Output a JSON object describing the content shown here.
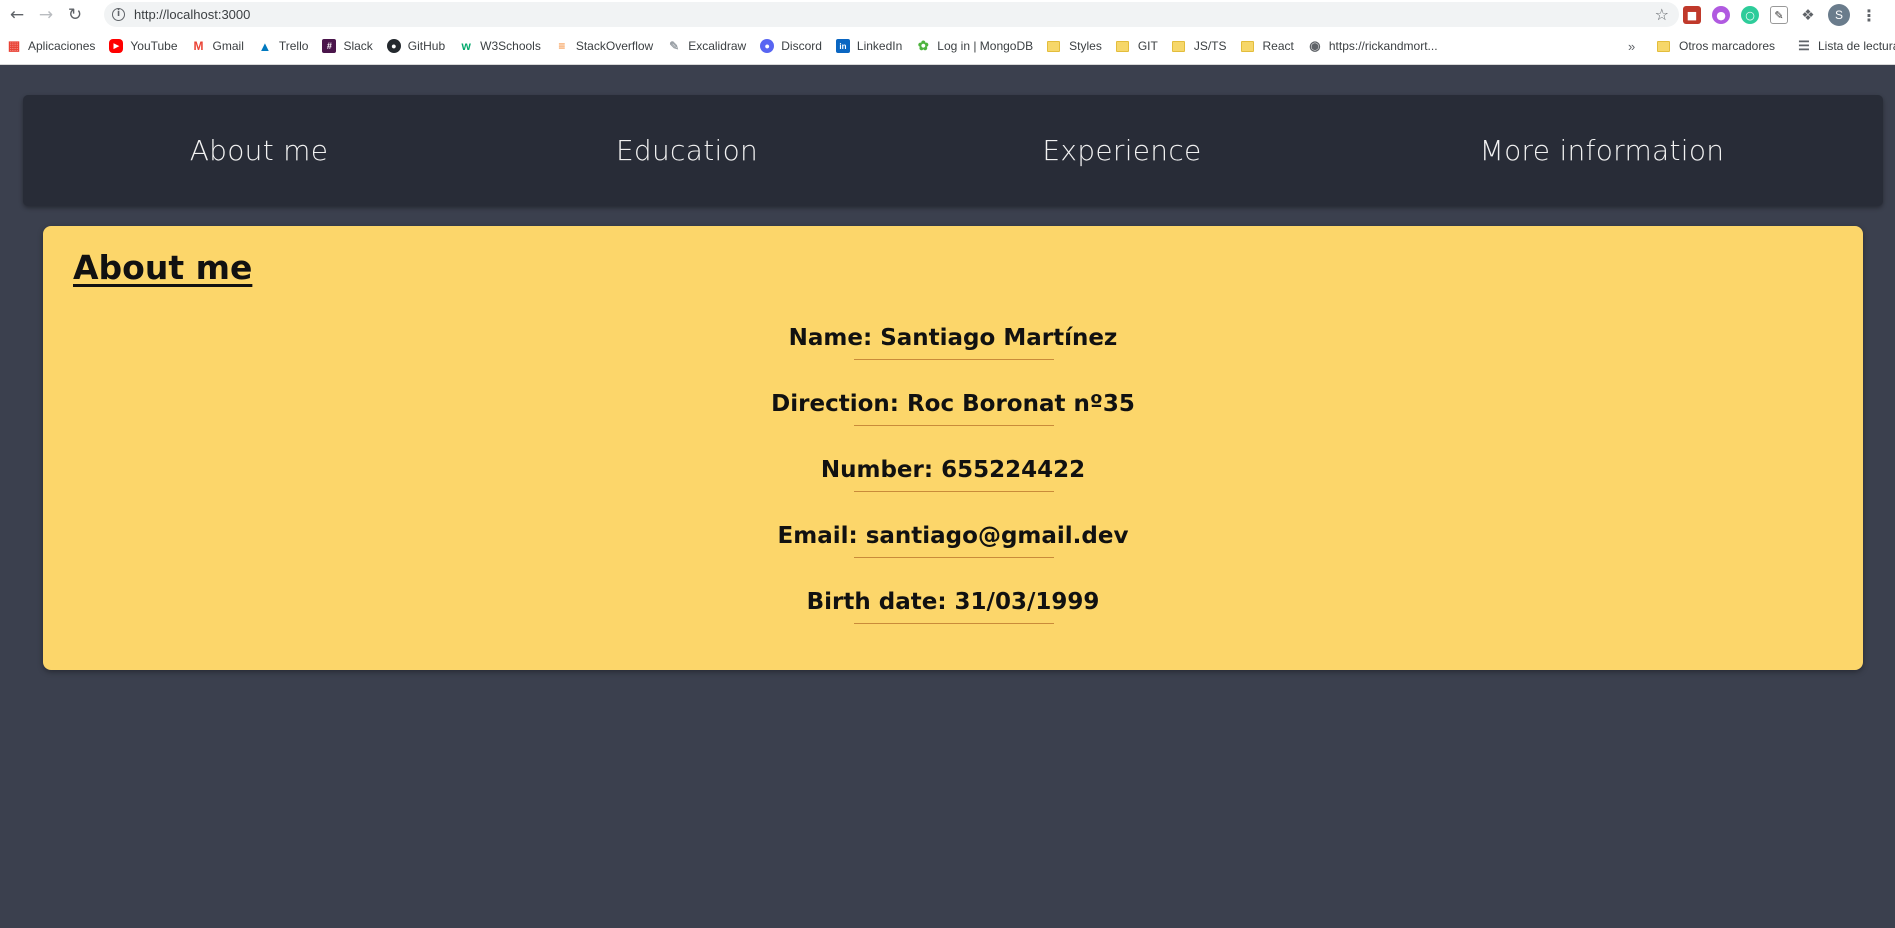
{
  "browser": {
    "url": "http://localhost:3000",
    "profile_initial": "S",
    "bookmarks": [
      {
        "label": "Aplicaciones",
        "icon": "apps-grid-icon",
        "color": "#e94235"
      },
      {
        "label": "YouTube",
        "icon": "youtube-icon",
        "color": "#ff0000"
      },
      {
        "label": "Gmail",
        "icon": "gmail-icon",
        "color": "#ea4335"
      },
      {
        "label": "Trello",
        "icon": "trello-icon",
        "color": "#0079bf"
      },
      {
        "label": "Slack",
        "icon": "slack-icon",
        "color": "#4a154b"
      },
      {
        "label": "GitHub",
        "icon": "github-icon",
        "color": "#24292e"
      },
      {
        "label": "W3Schools",
        "icon": "w3schools-icon",
        "color": "#04aa6d"
      },
      {
        "label": "StackOverflow",
        "icon": "stackoverflow-icon",
        "color": "#f48024"
      },
      {
        "label": "Excalidraw",
        "icon": "excalidraw-icon",
        "color": "#9aa0a6"
      },
      {
        "label": "Discord",
        "icon": "discord-icon",
        "color": "#5865f2"
      },
      {
        "label": "LinkedIn",
        "icon": "linkedin-icon",
        "color": "#0a66c2"
      },
      {
        "label": "Log in | MongoDB",
        "icon": "mongodb-icon",
        "color": "#4db33d"
      },
      {
        "label": "Styles",
        "icon": "folder-icon",
        "color": "#f6d76a"
      },
      {
        "label": "GIT",
        "icon": "folder-icon",
        "color": "#f6d76a"
      },
      {
        "label": "JS/TS",
        "icon": "folder-icon",
        "color": "#f6d76a"
      },
      {
        "label": "React",
        "icon": "folder-icon",
        "color": "#f6d76a"
      },
      {
        "label": "https://rickandmort...",
        "icon": "globe-icon",
        "color": "#5f6368"
      }
    ],
    "overflow_label": "»",
    "other_bookmarks": "Otros marcadores",
    "reading_list": "Lista de lectura"
  },
  "nav": {
    "items": [
      {
        "label": "About me"
      },
      {
        "label": "Education"
      },
      {
        "label": "Experience"
      },
      {
        "label": "More information"
      }
    ]
  },
  "about": {
    "title": "About me",
    "items": [
      {
        "text": "Name: Santiago Martínez"
      },
      {
        "text": "Direction: Roc Boronat nº35"
      },
      {
        "text": "Number: 655224422"
      },
      {
        "text": "Email: santiago@gmail.dev"
      },
      {
        "text": "Birth date: 31/03/1999"
      }
    ]
  },
  "colors": {
    "page_bg": "#3b404e",
    "navbar_bg": "#282c37",
    "card_bg": "#fcd66a",
    "divider": "#c98b3a"
  }
}
